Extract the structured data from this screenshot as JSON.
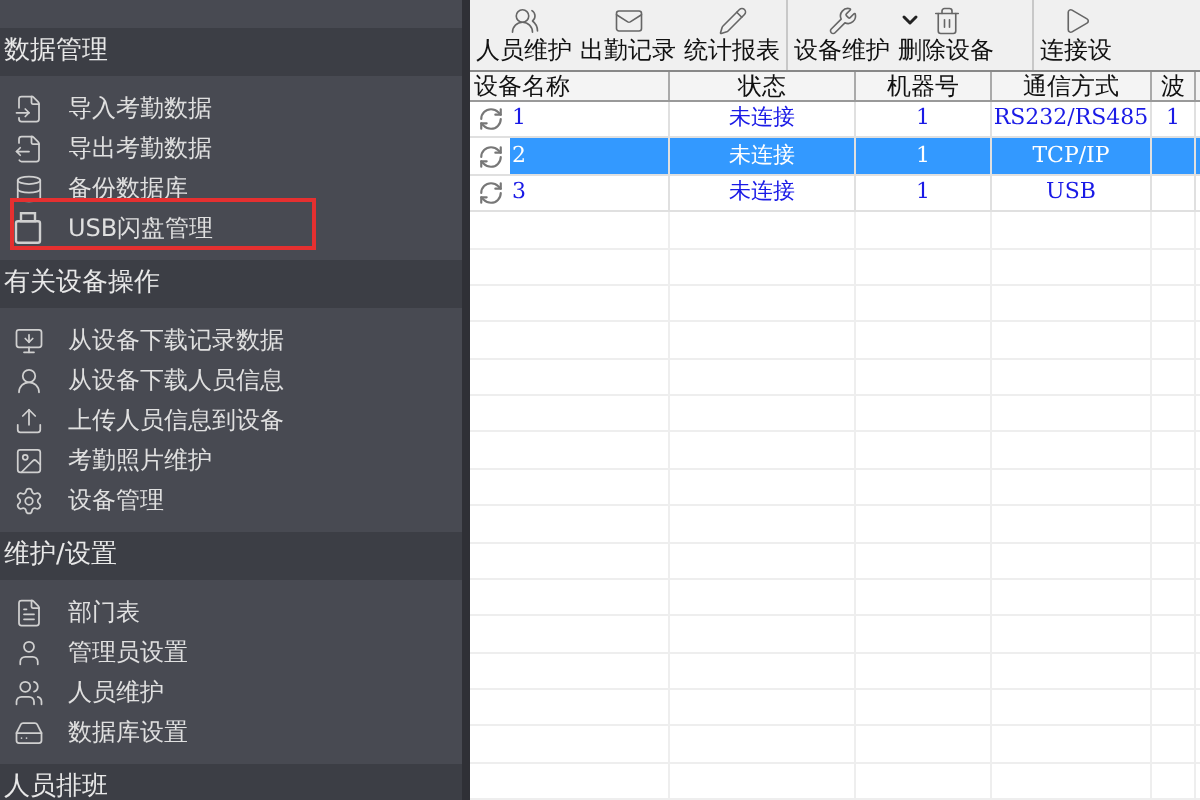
{
  "sidebar": {
    "sections": [
      {
        "title": "数据管理",
        "items": [
          {
            "label": "导入考勤数据",
            "highlighted": false
          },
          {
            "label": "导出考勤数据",
            "highlighted": false
          },
          {
            "label": "备份数据库",
            "highlighted": false
          },
          {
            "label": "USB闪盘管理",
            "highlighted": true
          }
        ]
      },
      {
        "title": "有关设备操作",
        "items": [
          {
            "label": "从设备下载记录数据",
            "highlighted": false
          },
          {
            "label": "从设备下载人员信息",
            "highlighted": false
          },
          {
            "label": "上传人员信息到设备",
            "highlighted": false
          },
          {
            "label": "考勤照片维护",
            "highlighted": false
          },
          {
            "label": "设备管理",
            "highlighted": false
          }
        ]
      },
      {
        "title": "维护/设置",
        "items": [
          {
            "label": "部门表",
            "highlighted": false
          },
          {
            "label": "管理员设置",
            "highlighted": false
          },
          {
            "label": "人员维护",
            "highlighted": false
          },
          {
            "label": "数据库设置",
            "highlighted": false
          }
        ]
      },
      {
        "title": "人员排班"
      }
    ]
  },
  "toolbar": {
    "groups": [
      [
        {
          "label": "人员维护",
          "kind": "button"
        },
        {
          "label": "出勤记录",
          "kind": "button"
        },
        {
          "label": "统计报表",
          "kind": "button"
        }
      ],
      [
        {
          "label": "设备维护",
          "kind": "dropdown"
        },
        {
          "label": "删除设备",
          "kind": "button"
        }
      ],
      [
        {
          "label": "连接设",
          "kind": "button"
        }
      ]
    ]
  },
  "table": {
    "columns": [
      "设备名称",
      "状态",
      "机器号",
      "通信方式",
      "波"
    ],
    "rows": [
      {
        "cells": [
          "1",
          "未连接",
          "1",
          "RS232/RS485",
          "1"
        ],
        "selected": false
      },
      {
        "cells": [
          "2",
          "未连接",
          "1",
          "TCP/IP"
        ],
        "selected": true
      },
      {
        "cells": [
          "3",
          "未连接",
          "1",
          "USB"
        ],
        "selected": false
      }
    ]
  }
}
